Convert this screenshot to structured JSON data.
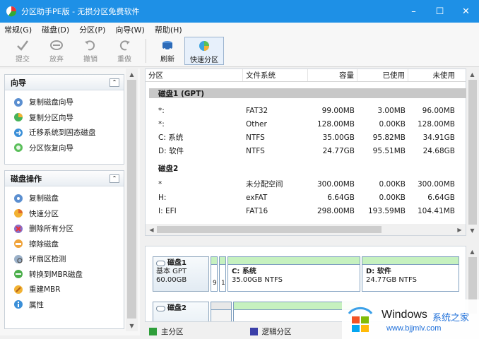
{
  "window": {
    "title": "分区助手PE版 - 无损分区免费软件",
    "accent": "#1e90e6"
  },
  "menu": [
    "常规(G)",
    "磁盘(D)",
    "分区(P)",
    "向导(W)",
    "帮助(H)"
  ],
  "toolbar": {
    "commit": "提交",
    "discard": "放弃",
    "undo": "撤销",
    "redo": "重做",
    "refresh": "刷新",
    "quick_partition": "快速分区"
  },
  "sidebar": {
    "wizard_title": "向导",
    "wizard_items": [
      "复制磁盘向导",
      "复制分区向导",
      "迁移系统到固态磁盘",
      "分区恢复向导"
    ],
    "ops_title": "磁盘操作",
    "ops_items": [
      "复制磁盘",
      "快速分区",
      "删除所有分区",
      "擦除磁盘",
      "坏扇区检测",
      "转换到MBR磁盘",
      "重建MBR",
      "属性"
    ]
  },
  "table": {
    "headers": [
      "分区",
      "文件系统",
      "容量",
      "已使用",
      "未使用"
    ],
    "disks": [
      {
        "title": "磁盘1 (GPT)",
        "rows": [
          [
            "*:",
            "FAT32",
            "99.00MB",
            "3.00MB",
            "96.00MB"
          ],
          [
            "*:",
            "Other",
            "128.00MB",
            "0.00KB",
            "128.00MB"
          ],
          [
            "C: 系统",
            "NTFS",
            "35.00GB",
            "95.82MB",
            "34.91GB"
          ],
          [
            "D: 软件",
            "NTFS",
            "24.77GB",
            "95.51MB",
            "24.68GB"
          ]
        ]
      },
      {
        "title": "磁盘2",
        "rows": [
          [
            "*",
            "未分配空间",
            "300.00MB",
            "0.00KB",
            "300.00MB"
          ],
          [
            "H:",
            "exFAT",
            "6.64GB",
            "0.00KB",
            "6.64GB"
          ],
          [
            "I: EFI",
            "FAT16",
            "298.00MB",
            "193.59MB",
            "104.41MB"
          ]
        ]
      }
    ]
  },
  "diskmap": {
    "disk1": {
      "name": "磁盘1",
      "type": "基本 GPT",
      "size": "60.00GB",
      "mini1": "9",
      "mini2": "1",
      "part_c_name": "C: 系统",
      "part_c_desc": "35.00GB NTFS",
      "part_d_name": "D: 软件",
      "part_d_desc": "24.77GB NTFS"
    },
    "disk2": {
      "name": "磁盘2"
    }
  },
  "legend": {
    "primary": "主分区",
    "logical": "逻辑分区"
  },
  "watermark": {
    "brand": "Windows",
    "brand_cn": "系统之家",
    "url": "www.bjjmlv.com"
  }
}
